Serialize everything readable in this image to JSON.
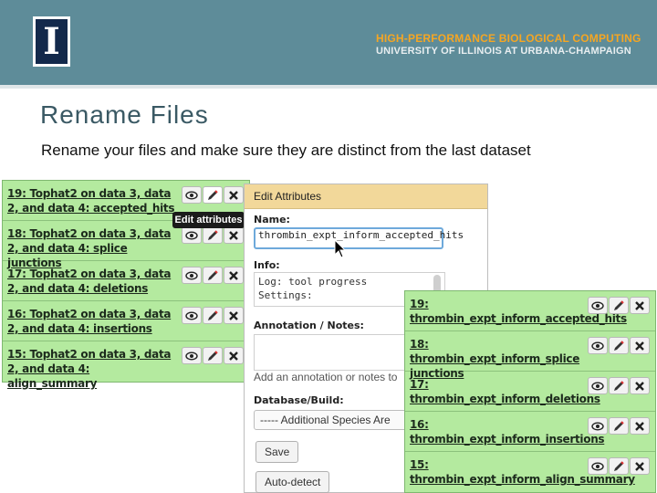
{
  "header": {
    "logo_letter": "I",
    "org_line1": "HIGH-PERFORMANCE BIOLOGICAL COMPUTING",
    "org_line2": "UNIVERSITY OF ILLINOIS AT URBANA-CHAMPAIGN",
    "colors": {
      "banner": "#5e8c99",
      "accent": "#f5a623"
    }
  },
  "slide": {
    "title": "Rename Files",
    "subtitle": "Rename your files and make sure they are distinct from the last dataset"
  },
  "history_left": {
    "items": [
      {
        "title": "19: Tophat2 on data 3, data 2, and data 4: accepted_hits"
      },
      {
        "title": "18: Tophat2 on data 3, data 2, and data 4: splice junctions"
      },
      {
        "title": "17: Tophat2 on data 3, data 2, and data 4: deletions"
      },
      {
        "title": "16: Tophat2 on data 3, data 2, and data 4: insertions"
      },
      {
        "title": "15: Tophat2 on data 3, data 2, and data 4: align_summary"
      }
    ],
    "icons": [
      "eye-icon",
      "pencil-icon",
      "delete-icon"
    ],
    "tooltip": "Edit attributes"
  },
  "edit_form": {
    "header": "Edit Attributes",
    "name_label": "Name:",
    "name_value": "thrombin_expt_inform_accepted_hits",
    "info_label": "Info:",
    "info_lines": [
      "Log: tool progress",
      "Settings:"
    ],
    "annotation_label": "Annotation / Notes:",
    "annotation_placeholder": "Add an annotation or notes to",
    "database_label": "Database/Build:",
    "database_value": "----- Additional Species Are",
    "save_button": "Save",
    "autodetect_button": "Auto-detect"
  },
  "history_right": {
    "items": [
      {
        "title": "19: thrombin_expt_inform_accepted_hits"
      },
      {
        "title": "18: thrombin_expt_inform_splice junctions"
      },
      {
        "title": "17: thrombin_expt_inform_deletions"
      },
      {
        "title": "16: thrombin_expt_inform_insertions"
      },
      {
        "title": "15: thrombin_expt_inform_align_summary"
      }
    ]
  }
}
